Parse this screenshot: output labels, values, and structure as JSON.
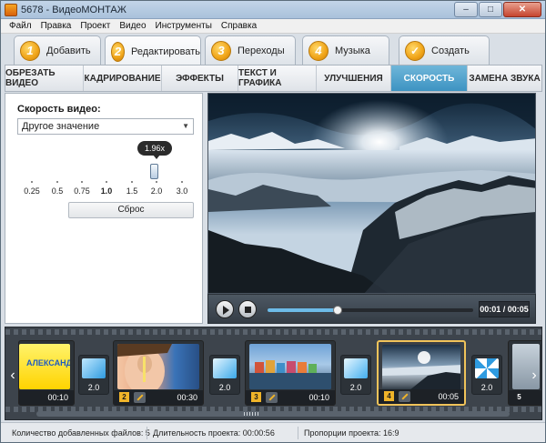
{
  "window": {
    "title": "5678 - ВидеоМОНТАЖ",
    "minimize": "–",
    "maximize": "□",
    "close": "✕"
  },
  "menu": [
    "Файл",
    "Правка",
    "Проект",
    "Видео",
    "Инструменты",
    "Справка"
  ],
  "steps": [
    {
      "badge": "1",
      "label": "Добавить"
    },
    {
      "badge": "2",
      "label": "Редактировать",
      "active": true
    },
    {
      "badge": "3",
      "label": "Переходы"
    },
    {
      "badge": "4",
      "label": "Музыка"
    },
    {
      "badge": "✓",
      "label": "Создать"
    }
  ],
  "subtabs": [
    {
      "label": "ОБРЕЗАТЬ ВИДЕО"
    },
    {
      "label": "КАДРИРОВАНИЕ"
    },
    {
      "label": "ЭФФЕКТЫ"
    },
    {
      "label": "ТЕКСТ И ГРАФИКА"
    },
    {
      "label": "УЛУЧШЕНИЯ"
    },
    {
      "label": "СКОРОСТЬ",
      "active": true
    },
    {
      "label": "ЗАМЕНА ЗВУКА"
    }
  ],
  "speed_panel": {
    "label": "Скорость видео:",
    "dropdown_value": "Другое значение",
    "tooltip": "1.96x",
    "slider_value": 1.96,
    "scale_labels": [
      "0.25",
      "0.5",
      "0.75",
      "1.0",
      "1.5",
      "2.0",
      "3.0"
    ],
    "reset_label": "Сброс"
  },
  "player": {
    "time": "00:01 / 00:05",
    "progress_fraction": 0.34
  },
  "timeline": {
    "clips": [
      {
        "num": "",
        "duration": "00:10",
        "thumb": "yellow",
        "caption": "АЛЕКСАНДРА",
        "partial": true
      },
      {
        "num": "2",
        "duration": "00:30",
        "thumb": "face"
      },
      {
        "num": "3",
        "duration": "00:10",
        "thumb": "harbor"
      },
      {
        "num": "4",
        "duration": "00:05",
        "thumb": "mountain",
        "selected": true
      },
      {
        "num": "",
        "duration": "5",
        "thumb": "grey",
        "partial": true
      }
    ],
    "transitions": [
      {
        "duration": "2.0"
      },
      {
        "duration": "2.0"
      },
      {
        "duration": "2.0"
      },
      {
        "duration": "2.0"
      }
    ]
  },
  "status": {
    "files": "Количество добавленных файлов: 5",
    "duration": "Длительность проекта: 00:00:56",
    "aspect": "Пропорции проекта: 16:9"
  },
  "colors": {
    "accent": "#3d93c2",
    "step_badge": "#f0a418",
    "selected_clip": "#f0c35a"
  }
}
